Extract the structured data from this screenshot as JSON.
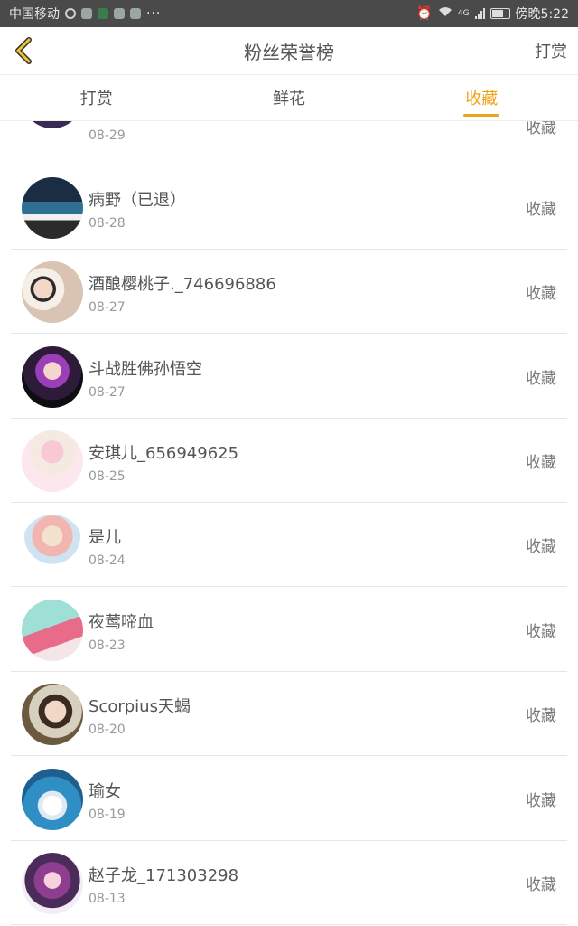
{
  "status_bar": {
    "carrier": "中国移动",
    "time": "傍晚5:22",
    "network": "4G"
  },
  "header": {
    "title": "粉丝荣誉榜",
    "action_label": "打赏"
  },
  "tabs": [
    {
      "label": "打赏",
      "active": false
    },
    {
      "label": "鲜花",
      "active": false
    },
    {
      "label": "收藏",
      "active": true
    }
  ],
  "list": {
    "items": [
      {
        "name": "",
        "date": "08-29",
        "action": "收藏"
      },
      {
        "name": "病野（已退）",
        "date": "08-28",
        "action": "收藏"
      },
      {
        "name": "酒酿樱桃子._746696886",
        "date": "08-27",
        "action": "收藏"
      },
      {
        "name": "斗战胜佛孙悟空",
        "date": "08-27",
        "action": "收藏"
      },
      {
        "name": "安琪儿_656949625",
        "date": "08-25",
        "action": "收藏"
      },
      {
        "name": "是儿",
        "date": "08-24",
        "action": "收藏"
      },
      {
        "name": "夜莺啼血",
        "date": "08-23",
        "action": "收藏"
      },
      {
        "name": "Scorpius天蝎",
        "date": "08-20",
        "action": "收藏"
      },
      {
        "name": "瑜女",
        "date": "08-19",
        "action": "收藏"
      },
      {
        "name": "赵子龙_171303298",
        "date": "08-13",
        "action": "收藏"
      }
    ]
  },
  "colors": {
    "accent": "#f0a21a",
    "status_bar_bg": "#4a4a4a",
    "text_primary": "#555555",
    "text_secondary": "#999999"
  }
}
